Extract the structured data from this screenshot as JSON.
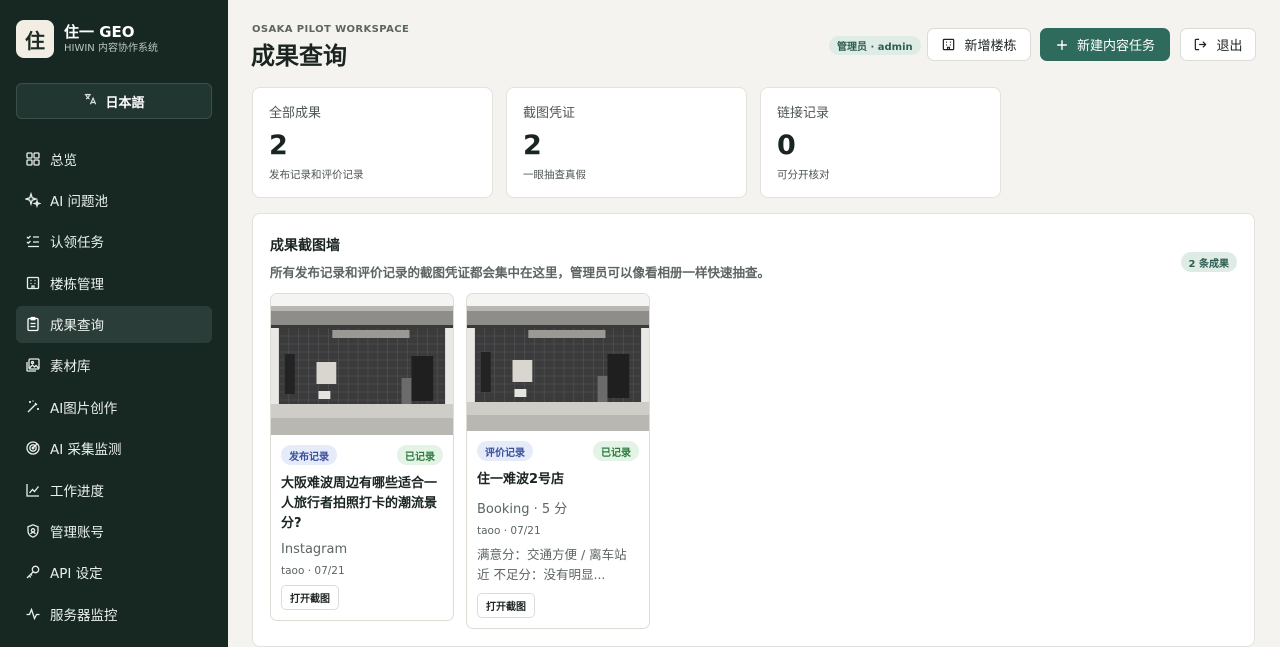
{
  "brand": {
    "logo_char": "住",
    "title": "住一 GEO",
    "subtitle": "HIWIN 内容协作系统"
  },
  "language_button": {
    "label": "日本語",
    "icon": "translate-icon"
  },
  "nav": [
    {
      "label": "总览",
      "icon": "dashboard-icon",
      "active": false
    },
    {
      "label": "AI 问题池",
      "icon": "sparkle-icon",
      "active": false
    },
    {
      "label": "认领任务",
      "icon": "checklist-icon",
      "active": false
    },
    {
      "label": "楼栋管理",
      "icon": "building-icon",
      "active": false
    },
    {
      "label": "成果查询",
      "icon": "clipboard-icon",
      "active": true
    },
    {
      "label": "素材库",
      "icon": "images-icon",
      "active": false
    },
    {
      "label": "AI图片创作",
      "icon": "magic-wand-icon",
      "active": false
    },
    {
      "label": "AI 采集监测",
      "icon": "radar-icon",
      "active": false
    },
    {
      "label": "工作进度",
      "icon": "chart-line-icon",
      "active": false
    },
    {
      "label": "管理账号",
      "icon": "shield-icon",
      "active": false
    },
    {
      "label": "API 设定",
      "icon": "key-icon",
      "active": false
    },
    {
      "label": "服务器监控",
      "icon": "activity-icon",
      "active": false
    }
  ],
  "header": {
    "eyebrow": "OSAKA PILOT WORKSPACE",
    "title": "成果查询",
    "role_badge": "管理员 · admin",
    "add_building_label": "新增楼栋",
    "new_task_label": "新建内容任务",
    "logout_label": "退出"
  },
  "stats": [
    {
      "label": "全部成果",
      "value": "2",
      "desc": "发布记录和评价记录"
    },
    {
      "label": "截图凭证",
      "value": "2",
      "desc": "一眼抽查真假"
    },
    {
      "label": "链接记录",
      "value": "0",
      "desc": "可分开核对"
    }
  ],
  "wall": {
    "title": "成果截图墙",
    "desc": "所有发布记录和评价记录的截图凭证都会集中在这里，管理员可以像看相册一样快速抽查。",
    "count_badge": "2 条成果",
    "cards": [
      {
        "type": "发布记录",
        "status": "已记录",
        "title": "大阪难波周边有哪些适合一人旅行者拍照打卡的潮流景分?",
        "platform": "Instagram",
        "meta": "taoo · 07/21",
        "text": "",
        "open_label": "打开截图"
      },
      {
        "type": "评价记录",
        "status": "已记录",
        "title": "住一难波2号店",
        "platform": "Booking · 5 分",
        "meta": "taoo · 07/21",
        "text": "满意分：交通方便 / 离车站近 不足分：没有明显...",
        "open_label": "打开截图"
      }
    ]
  },
  "colors": {
    "sidebar": "#172822",
    "primary": "#2e6b5c",
    "background": "#f4f3ef"
  }
}
